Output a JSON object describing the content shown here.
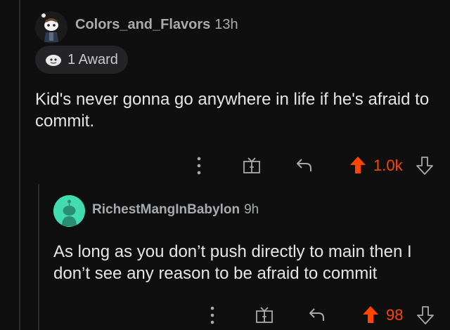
{
  "comments": [
    {
      "username": "Colors_and_Flavors",
      "time": "13h",
      "award_count_label": "1 Award",
      "body": "Kid's never gonna go anywhere in life if he's afraid to commit.",
      "score": "1.0k"
    },
    {
      "username": "RichestMangInBabylon",
      "time": "9h",
      "body": "As long as you don’t push directly to main then I don’t see any reason to be afraid to commit",
      "score": "98"
    }
  ],
  "colors": {
    "background": "#0f0f0f",
    "upvote_orange": "#ff4500",
    "reply_avatar_teal": "#43dcb0"
  },
  "icons": {
    "more": "more-vertical-icon",
    "award": "award-icon",
    "reply": "reply-icon",
    "upvote": "upvote-arrow-icon",
    "downvote": "downvote-arrow-icon"
  }
}
